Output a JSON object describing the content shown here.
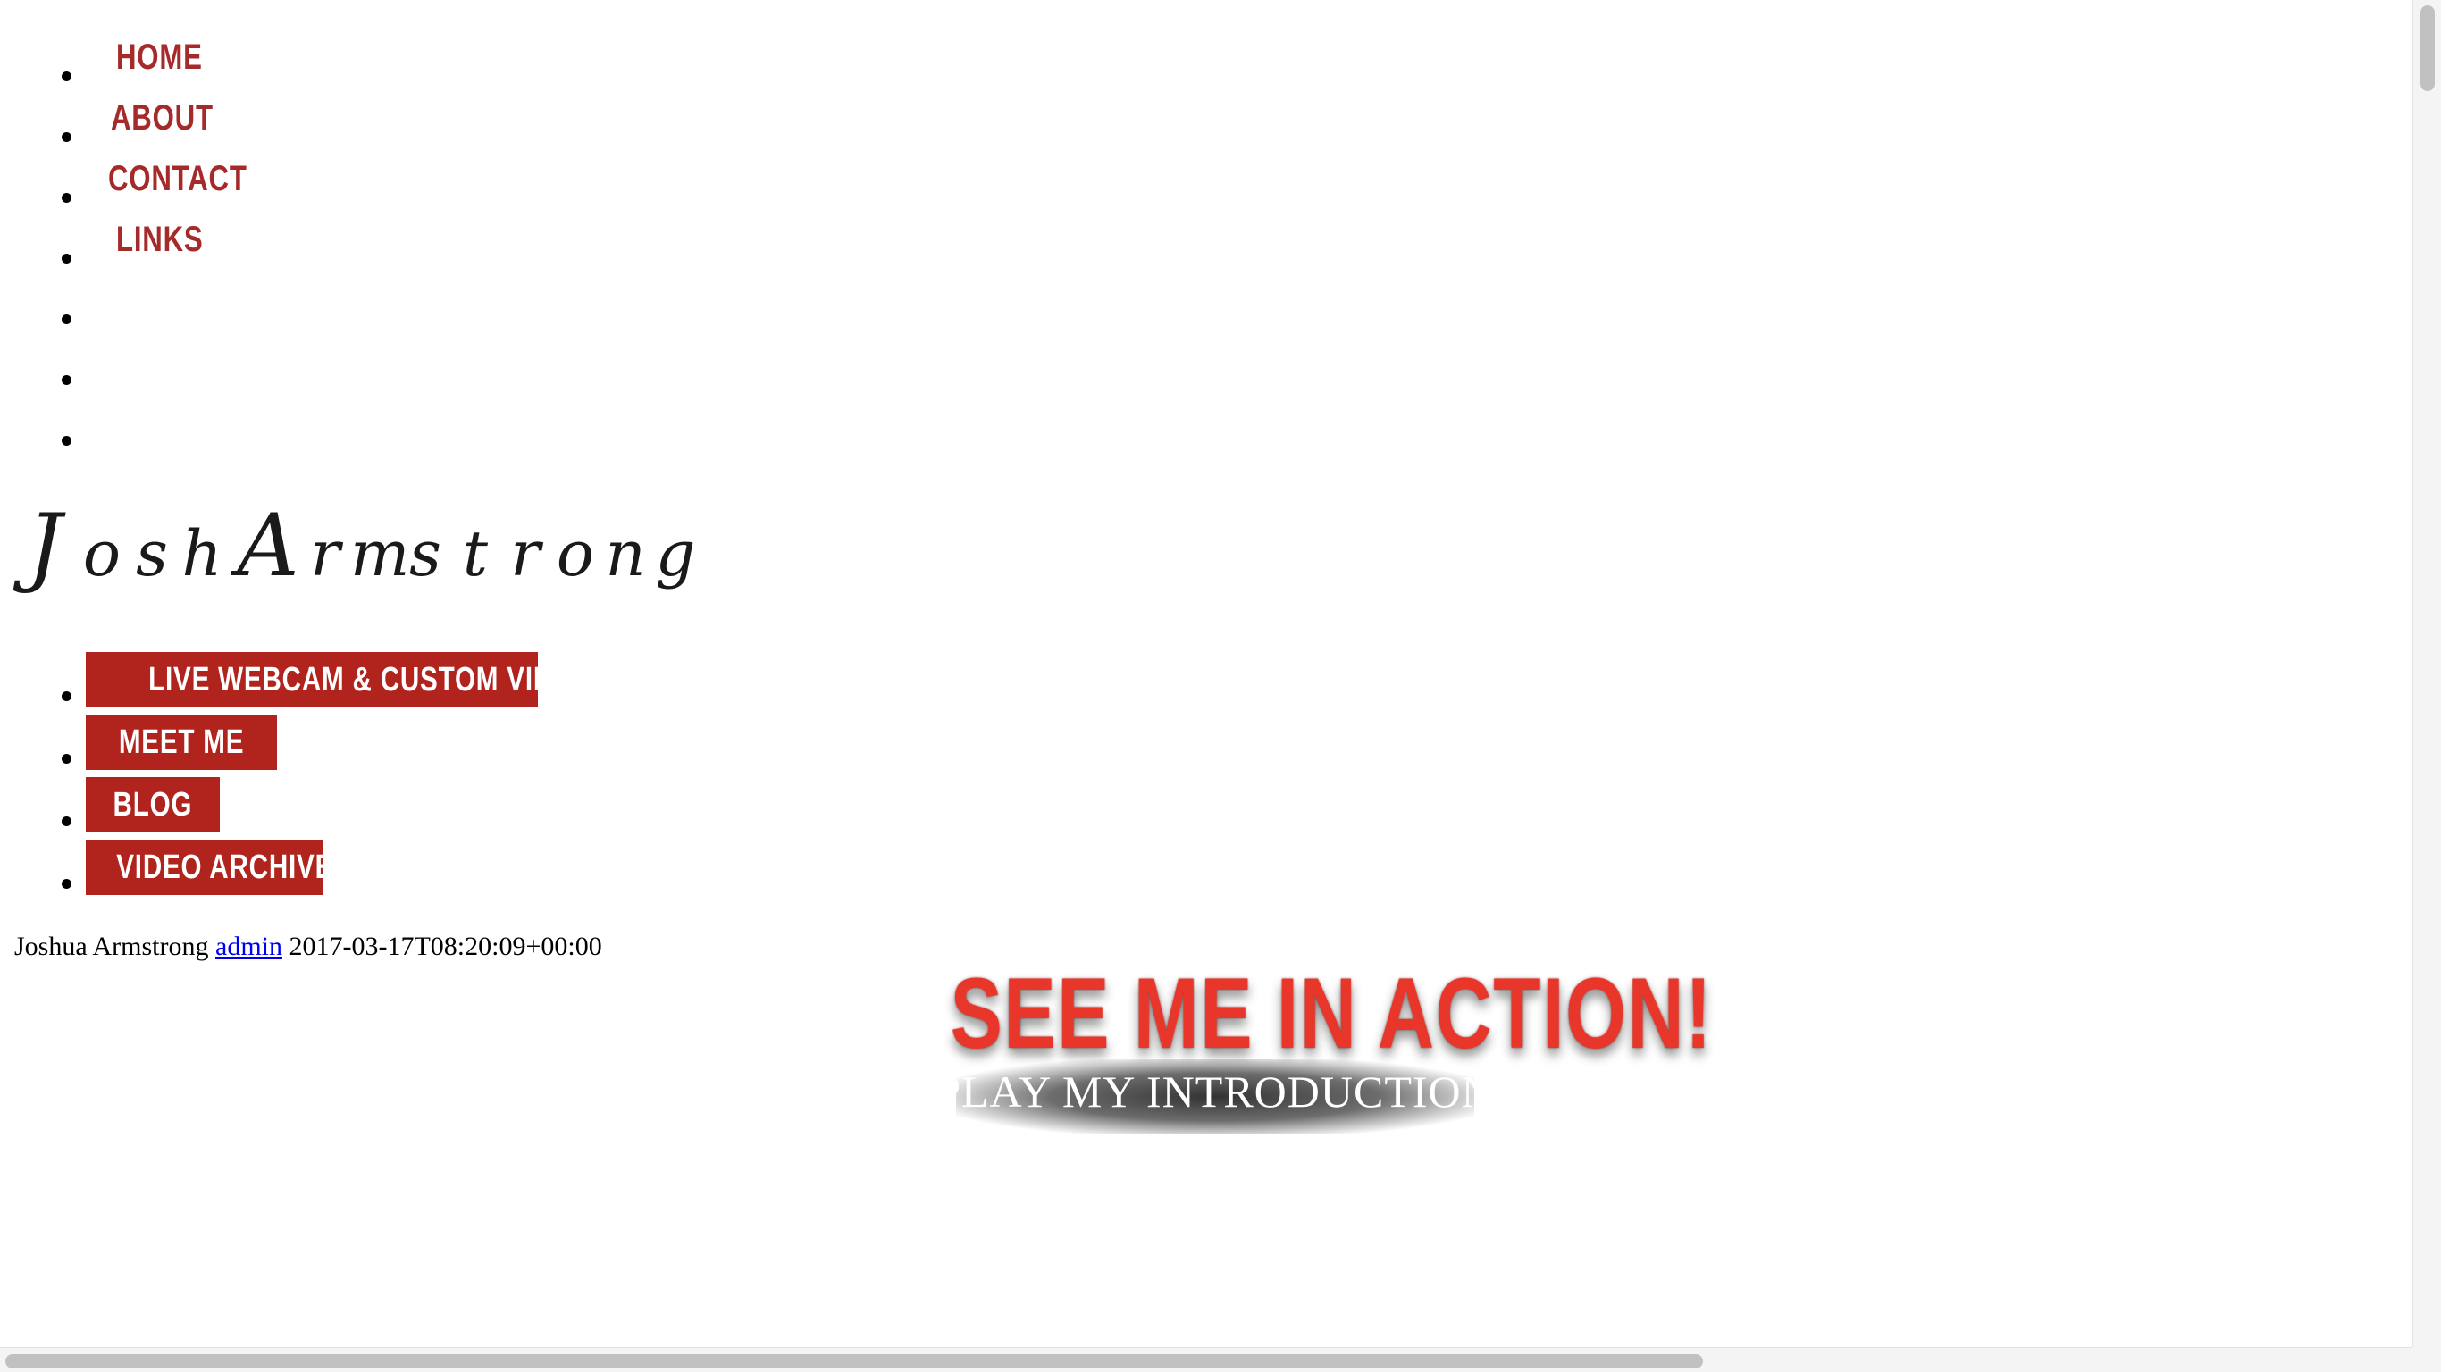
{
  "top_nav": {
    "items": [
      {
        "label": "HOME"
      },
      {
        "label": "ABOUT"
      },
      {
        "label": "CONTACT"
      },
      {
        "label": "LINKS"
      },
      {
        "label": ""
      },
      {
        "label": ""
      },
      {
        "label": ""
      }
    ]
  },
  "logo": {
    "text": "Josh Armstrong"
  },
  "main_nav": {
    "items": [
      {
        "label": "LIVE WEBCAM & CUSTOM VIDEO"
      },
      {
        "label": "MEET ME"
      },
      {
        "label": "BLOG"
      },
      {
        "label": "VIDEO ARCHIVE"
      }
    ]
  },
  "post_meta": {
    "author_name": "Joshua Armstrong",
    "author_link": "admin",
    "datetime": "2017-03-17T08:20:09+00:00"
  },
  "promo": {
    "title": "SEE ME IN ACTION!",
    "subtitle": "PLAY MY INTRODUCTION"
  },
  "colors": {
    "nav_text": "#a52a2a",
    "button_bg": "#b0241d",
    "promo_red": "#e8372a",
    "link": "#0000ee"
  }
}
